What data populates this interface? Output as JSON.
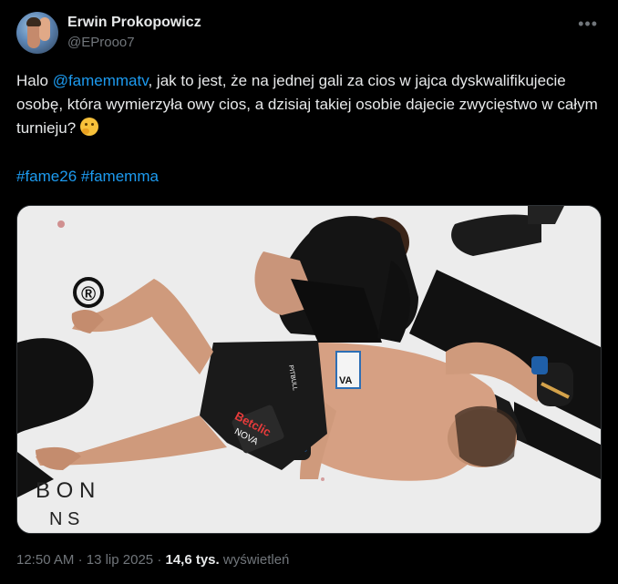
{
  "author": {
    "name": "Erwin Prokopowicz",
    "handle": "@EProoo7"
  },
  "tweet": {
    "text_1": "Halo ",
    "mention": "@famemmatv",
    "text_2": ", jak to jest, że na jednej gali za cios w jajca dyskwalifikujecie osobę, która wymierzyła owy cios, a dzisiaj takiej osobie dajecie zwycięstwo w całym turnieju? ",
    "emoji": "thinking-face",
    "hashtags": [
      "#fame26",
      "#famemma"
    ]
  },
  "media": {
    "logo_mark": "®",
    "mat_letters": "B O N",
    "mat_letters_2": "N S",
    "fighter_waistband": "PITBULL",
    "trunks_sponsor": "Betclic",
    "trunks_sponsor_2": "NOVA",
    "waist_sponsor": "VA"
  },
  "meta": {
    "time": "12:50 AM",
    "separator": "·",
    "date": "13 lip 2025",
    "views_count": "14,6 tys.",
    "views_label": "wyświetleń"
  },
  "icons": {
    "more": "more-icon"
  }
}
